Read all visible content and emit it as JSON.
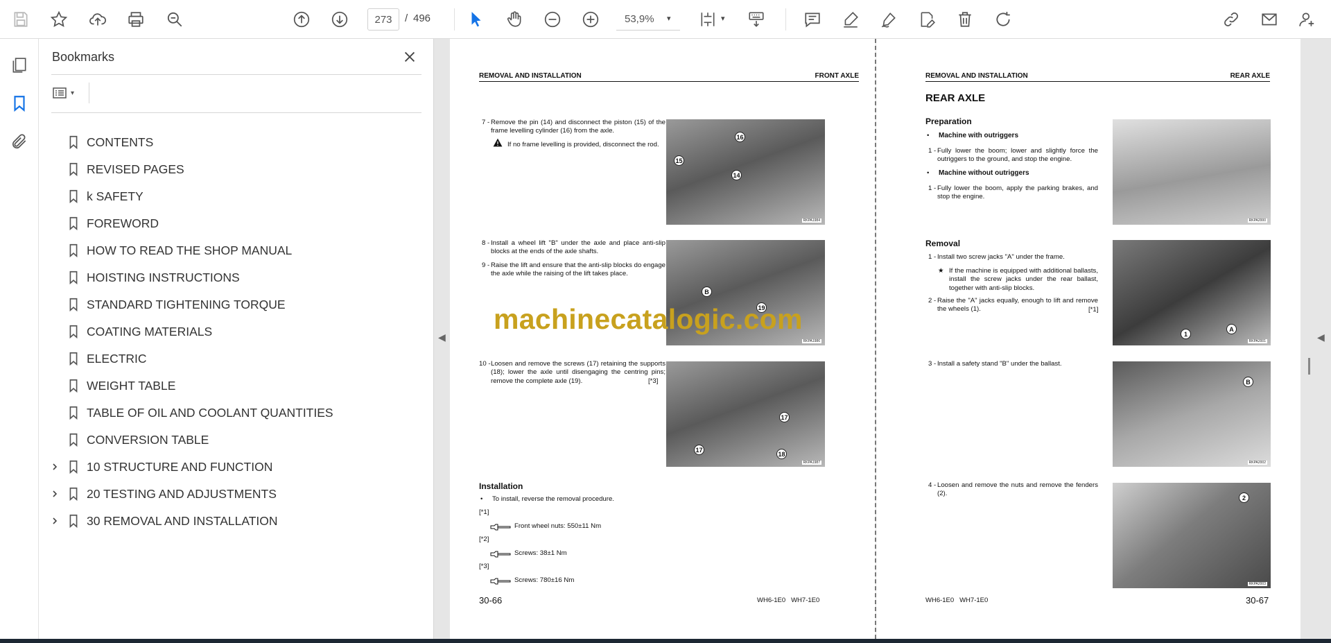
{
  "toolbar": {
    "current_page": "273",
    "page_separator": "/",
    "total_pages": "496",
    "zoom": "53,9%"
  },
  "panel": {
    "title": "Bookmarks",
    "items": [
      {
        "label": "CONTENTS",
        "expandable": false
      },
      {
        "label": "REVISED PAGES",
        "expandable": false
      },
      {
        "label": "k SAFETY",
        "expandable": false
      },
      {
        "label": "FOREWORD",
        "expandable": false
      },
      {
        "label": "HOW TO READ THE SHOP MANUAL",
        "expandable": false
      },
      {
        "label": "HOISTING INSTRUCTIONS",
        "expandable": false
      },
      {
        "label": "STANDARD TIGHTENING TORQUE",
        "expandable": false
      },
      {
        "label": "COATING MATERIALS",
        "expandable": false
      },
      {
        "label": "ELECTRIC",
        "expandable": false
      },
      {
        "label": "WEIGHT TABLE",
        "expandable": false
      },
      {
        "label": "TABLE OF OIL AND COOLANT QUANTITIES",
        "expandable": false
      },
      {
        "label": "CONVERSION TABLE",
        "expandable": false
      },
      {
        "label": "10 STRUCTURE AND FUNCTION",
        "expandable": true
      },
      {
        "label": "20 TESTING AND ADJUSTMENTS",
        "expandable": true
      },
      {
        "label": "30 REMOVAL AND INSTALLATION",
        "expandable": true
      }
    ]
  },
  "left_page": {
    "header_left": "REMOVAL AND INSTALLATION",
    "header_right": "FRONT AXLE",
    "step7_num": "7 -",
    "step7": "Remove the pin (14) and disconnect the piston (15) of the frame levelling cylinder (16) from the axle.",
    "step7_warn": "If no frame levelling is provided, disconnect the rod.",
    "step8_num": "8 -",
    "step8": "Install a wheel lift \"B\" under the axle and place anti-slip blocks at the ends of the axle shafts.",
    "step9_num": "9 -",
    "step9": "Raise the lift and ensure that the anti-slip blocks do engage the axle while the raising of the lift takes place.",
    "step10_num": "10 -",
    "step10": "Loosen and remove the screws (17) retaining the supports (18); lower the axle until disengaging the centring pins; remove the complete axle (19).",
    "step10_ref": "[*3]",
    "installation_title": "Installation",
    "installation_bullet": "•",
    "installation_text": "To install, reverse the removal procedure.",
    "ref1": "[*1]",
    "spec1": "Front wheel nuts: 550±11 Nm",
    "ref2": "[*2]",
    "spec2": "Screws: 38±1 Nm",
    "ref3": "[*3]",
    "spec3": "Screws: 780±16 Nm",
    "page_number": "30-66",
    "models": "WH6-1E0   WH7-1E0",
    "photo1_callouts": [
      "16",
      "15",
      "14"
    ],
    "photo2_callouts": [
      "B",
      "19"
    ],
    "photo3_callouts": [
      "17",
      "17",
      "18"
    ],
    "photo1_code": "RKPA1984",
    "photo2_code": "RKPA1986",
    "photo3_code": "RKPA1987"
  },
  "right_page": {
    "header_left": "REMOVAL AND INSTALLATION",
    "header_right": "REAR AXLE",
    "title": "REAR AXLE",
    "prep_title": "Preparation",
    "bullet": "•",
    "prep_a": "Machine with outriggers",
    "prep_a1_num": "1 -",
    "prep_a1": "Fully lower the boom; lower and slightly force the outriggers to the ground, and stop the engine.",
    "prep_b": "Machine without outriggers",
    "prep_b1_num": "1 -",
    "prep_b1": "Fully lower the boom, apply the parking brakes, and stop the engine.",
    "removal_title": "Removal",
    "step1_num": "1 -",
    "step1": "Install two screw jacks \"A\" under the frame.",
    "star": "★",
    "star_note": "If the machine is equipped with additional ballasts, install the screw jacks under the rear ballast, together with anti-slip blocks.",
    "step2_num": "2 -",
    "step2": "Raise the \"A\" jacks equally, enough to lift and remove the wheels (1).",
    "step2_ref": "[*1]",
    "step3_num": "3 -",
    "step3": "Install a safety stand \"B\" under the ballast.",
    "step4_num": "4 -",
    "step4": "Loosen and remove the nuts and remove the fenders (2).",
    "page_number": "30-67",
    "models": "WH6-1E0   WH7-1E0",
    "photo2_callouts": [
      "1",
      "A"
    ],
    "photo3_callouts": [
      "B"
    ],
    "photo4_callouts": [
      "2"
    ],
    "photo1_code": "RKPA2000",
    "photo2_code": "RKPA2001",
    "photo3_code": "RKPA2002",
    "photo4_code": "RKPA2003"
  },
  "watermark": "machinecatalogic.com",
  "colors": {
    "accent_blue": "#1473e6",
    "watermark": "#c8a11e",
    "icon_gray": "#555555"
  }
}
